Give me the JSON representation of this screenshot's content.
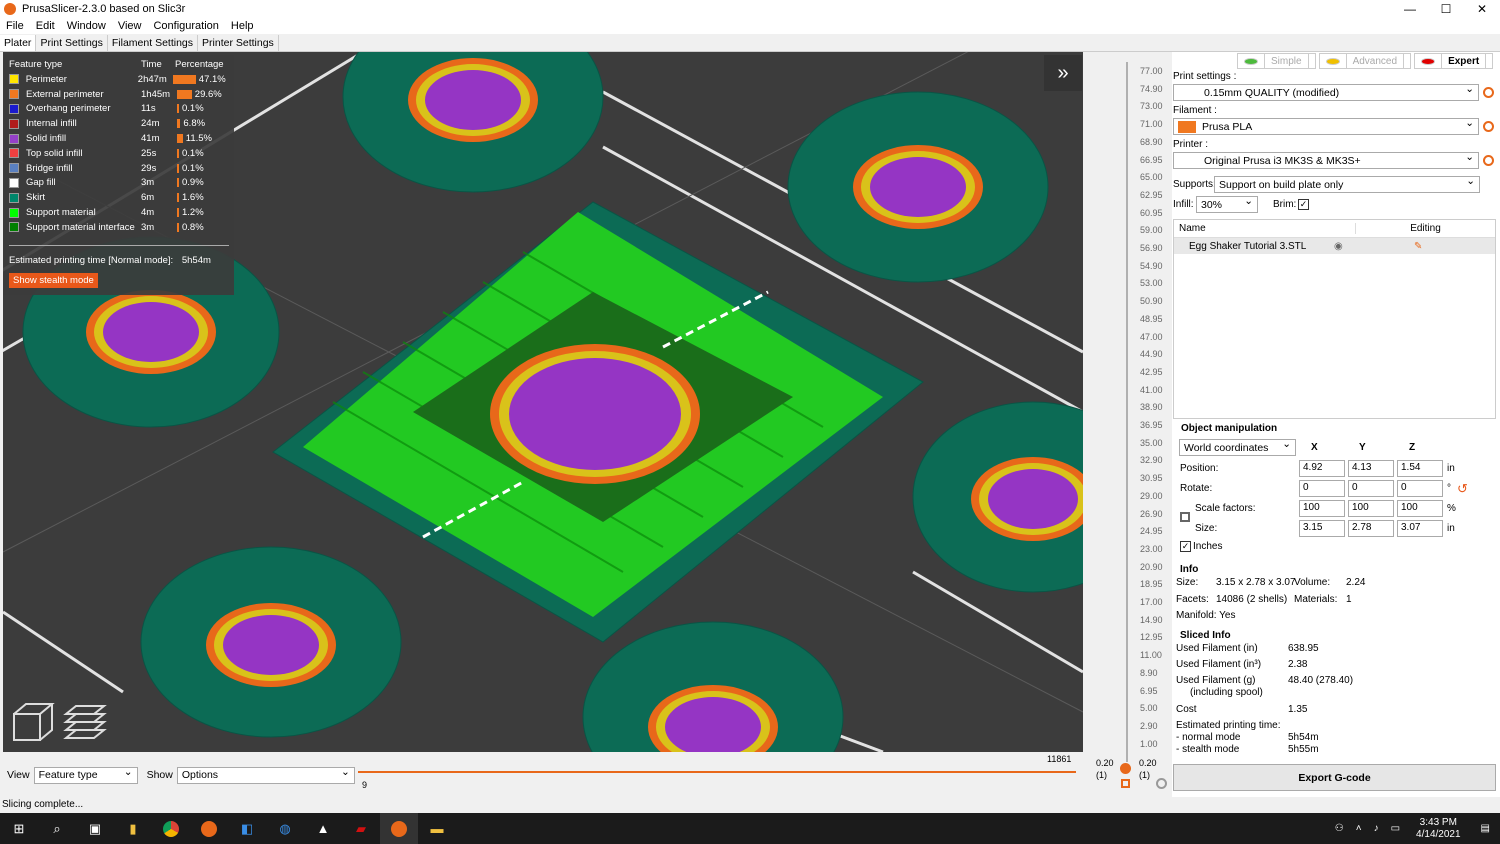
{
  "window": {
    "title": "PrusaSlicer-2.3.0 based on Slic3r",
    "min": "—",
    "max": "☐",
    "close": "✕"
  },
  "menu": [
    "File",
    "Edit",
    "Window",
    "View",
    "Configuration",
    "Help"
  ],
  "tabs": [
    "Plater",
    "Print Settings",
    "Filament Settings",
    "Printer Settings"
  ],
  "legend": {
    "headers": [
      "Feature type",
      "Time",
      "Percentage"
    ],
    "rows": [
      {
        "name": "Perimeter",
        "time": "2h47m",
        "pct": "47.1%",
        "color": "#ffe600",
        "frac": 0.471
      },
      {
        "name": "External perimeter",
        "time": "1h45m",
        "pct": "29.6%",
        "color": "#f07820",
        "frac": 0.296
      },
      {
        "name": "Overhang perimeter",
        "time": "11s",
        "pct": "0.1%",
        "color": "#1a1acc",
        "frac": 0.001
      },
      {
        "name": "Internal infill",
        "time": "24m",
        "pct": "6.8%",
        "color": "#b01b1b",
        "frac": 0.068
      },
      {
        "name": "Solid infill",
        "time": "41m",
        "pct": "11.5%",
        "color": "#9540c8",
        "frac": 0.115
      },
      {
        "name": "Top solid infill",
        "time": "25s",
        "pct": "0.1%",
        "color": "#f04040",
        "frac": 0.001
      },
      {
        "name": "Bridge infill",
        "time": "29s",
        "pct": "0.1%",
        "color": "#5a80c0",
        "frac": 0.001
      },
      {
        "name": "Gap fill",
        "time": "3m",
        "pct": "0.9%",
        "color": "#ffffff",
        "frac": 0.009
      },
      {
        "name": "Skirt",
        "time": "6m",
        "pct": "1.6%",
        "color": "#00866b",
        "frac": 0.016
      },
      {
        "name": "Support material",
        "time": "4m",
        "pct": "1.2%",
        "color": "#00ff00",
        "frac": 0.012
      },
      {
        "name": "Support material interface",
        "time": "3m",
        "pct": "0.8%",
        "color": "#008000",
        "frac": 0.008
      }
    ],
    "estimated": "Estimated printing time [Normal mode]:",
    "estimated_value": "5h54m",
    "stealth_button": "Show stealth mode"
  },
  "bottom": {
    "view_label": "View",
    "view_value": "Feature type",
    "show_label": "Show",
    "show_value": "Options",
    "slider_min": "9",
    "slider_max": "11861"
  },
  "ruler": {
    "ticks": [
      "77.00",
      "74.90",
      "73.00",
      "71.00",
      "68.90",
      "66.95",
      "65.00",
      "62.95",
      "60.95",
      "59.00",
      "56.90",
      "54.90",
      "53.00",
      "50.90",
      "48.95",
      "47.00",
      "44.90",
      "42.95",
      "41.00",
      "38.90",
      "36.95",
      "35.00",
      "32.90",
      "30.95",
      "29.00",
      "26.90",
      "24.95",
      "23.00",
      "20.90",
      "18.95",
      "17.00",
      "14.90",
      "12.95",
      "11.00",
      "8.90",
      "6.95",
      "5.00",
      "2.90",
      "1.00"
    ],
    "low_left": "0.20",
    "low_left2": "(1)",
    "low_right": "0.20",
    "low_right2": "(1)"
  },
  "modes": [
    "Simple",
    "Advanced",
    "Expert"
  ],
  "print_settings_label": "Print settings :",
  "print_settings_value": "0.15mm QUALITY (modified)",
  "filament_label": "Filament :",
  "filament_value": "Prusa PLA",
  "printer_label": "Printer :",
  "printer_value": "Original Prusa i3 MK3S & MK3S+",
  "supports_label": "Supports:",
  "supports_value": "Support on build plate only",
  "infill_label": "Infill:",
  "infill_value": "30%",
  "brim_label": "Brim:",
  "objlist": {
    "name_header": "Name",
    "editing_header": "Editing",
    "item": "Egg Shaker Tutorial 3.STL"
  },
  "om": {
    "title": "Object manipulation",
    "coords": "World coordinates",
    "x": "X",
    "y": "Y",
    "z": "Z",
    "position_label": "Position:",
    "position": [
      "4.92",
      "4.13",
      "1.54"
    ],
    "pos_unit": "in",
    "rotate_label": "Rotate:",
    "rotate": [
      "0",
      "0",
      "0"
    ],
    "rot_unit": "°",
    "scale_label": "Scale factors:",
    "scale": [
      "100",
      "100",
      "100"
    ],
    "scale_unit": "%",
    "size_label": "Size:",
    "size": [
      "3.15",
      "2.78",
      "3.07"
    ],
    "size_unit": "in",
    "inches_label": "Inches"
  },
  "info": {
    "title": "Info",
    "size_label": "Size:",
    "size_value": "3.15 x 2.78 x 3.07",
    "volume_label": "Volume:",
    "volume_value": "2.24",
    "facets_label": "Facets:",
    "facets_value": "14086 (2 shells)",
    "materials_label": "Materials:",
    "materials_value": "1",
    "manifold": "Manifold: Yes"
  },
  "sliced": {
    "title": "Sliced Info",
    "rows": [
      {
        "label": "Used Filament (in)",
        "value": "638.95"
      },
      {
        "label": "Used Filament (in³)",
        "value": "2.38"
      },
      {
        "label": "Used Filament (g)",
        "value": "48.40 (278.40)"
      },
      {
        "label": "(including spool)",
        "value": ""
      },
      {
        "label": "Cost",
        "value": "1.35"
      },
      {
        "label": "Estimated printing time:",
        "value": ""
      },
      {
        "label": "- normal mode",
        "value": "5h54m"
      },
      {
        "label": "- stealth mode",
        "value": "5h55m"
      }
    ]
  },
  "export_button": "Export G-code",
  "status": "Slicing complete...",
  "clock": {
    "time": "3:43 PM",
    "date": "4/14/2021"
  }
}
